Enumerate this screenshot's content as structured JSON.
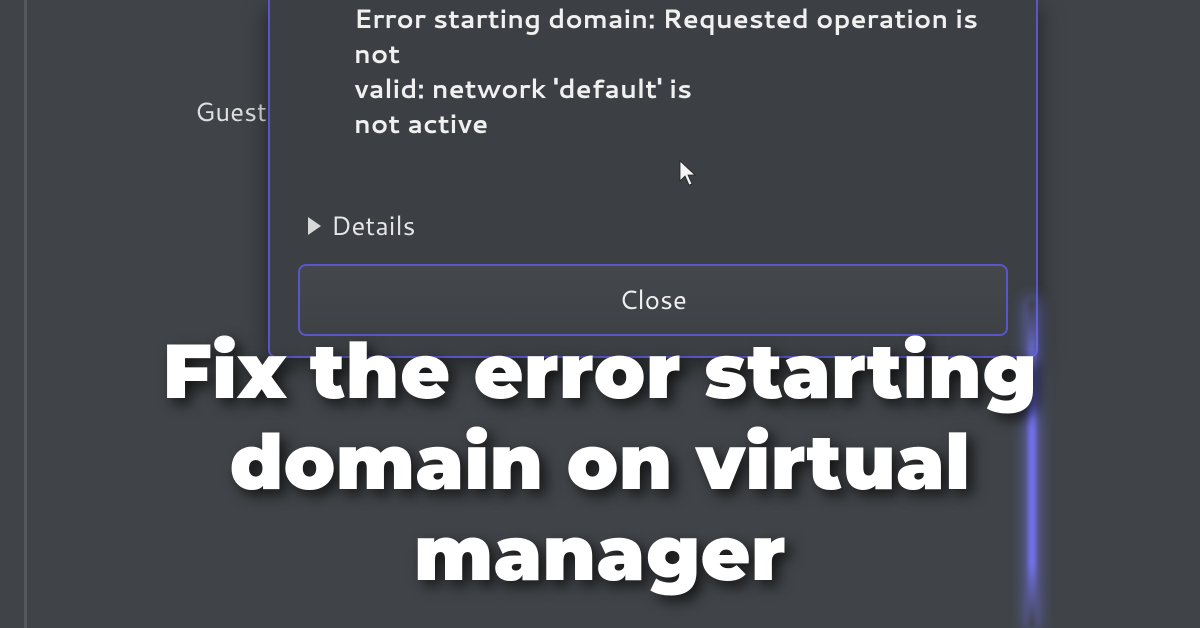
{
  "background": {
    "guest_label": "Guest i"
  },
  "dialog": {
    "error_line1": "Error starting domain: Requested operation is not",
    "error_line2": "valid: network 'default' is",
    "error_line3": "not active",
    "details_label": "Details",
    "close_label": "Close"
  },
  "overlay": {
    "title": "Fix the error starting domain on virtual manager"
  }
}
